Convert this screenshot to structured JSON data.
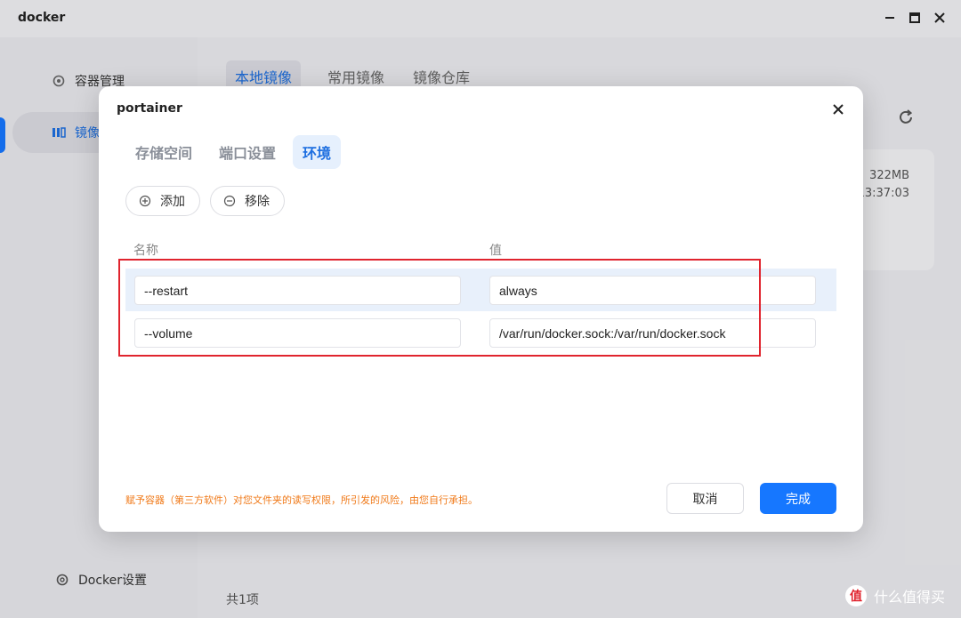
{
  "app": {
    "title": "docker",
    "window_controls": [
      "minimize",
      "maximize",
      "close"
    ]
  },
  "sidebar": {
    "items": [
      {
        "label": "容器管理",
        "icon": "gear-icon",
        "active": false
      },
      {
        "label": "镜像",
        "icon": "image-icon",
        "active": true
      }
    ],
    "settings_label": "Docker设置"
  },
  "main": {
    "tabs": [
      {
        "label": "本地镜像",
        "active": true
      },
      {
        "label": "常用镜像",
        "active": false
      },
      {
        "label": "镜像仓库",
        "active": false
      }
    ],
    "card": {
      "size": "322MB",
      "time": "13:37:03"
    },
    "footer_count": "共1项"
  },
  "modal": {
    "title": "portainer",
    "tabs": [
      {
        "label": "存储空间",
        "active": false
      },
      {
        "label": "端口设置",
        "active": false
      },
      {
        "label": "环境",
        "active": true
      }
    ],
    "add_label": "添加",
    "remove_label": "移除",
    "columns": {
      "name": "名称",
      "value": "值"
    },
    "rows": [
      {
        "name": "--restart",
        "value": "always"
      },
      {
        "name": "--volume",
        "value": "/var/run/docker.sock:/var/run/docker.sock"
      }
    ],
    "warning": "赋予容器（第三方软件）对您文件夹的读写权限，所引发的风险，由您自行承担。",
    "cancel_label": "取消",
    "confirm_label": "完成"
  },
  "watermark": {
    "logo": "值",
    "text": "什么值得买"
  },
  "colors": {
    "accent": "#1677ff",
    "warning": "#f07a1a",
    "highlight_box": "#e0242e",
    "row_highlight": "#e8f0fb"
  }
}
